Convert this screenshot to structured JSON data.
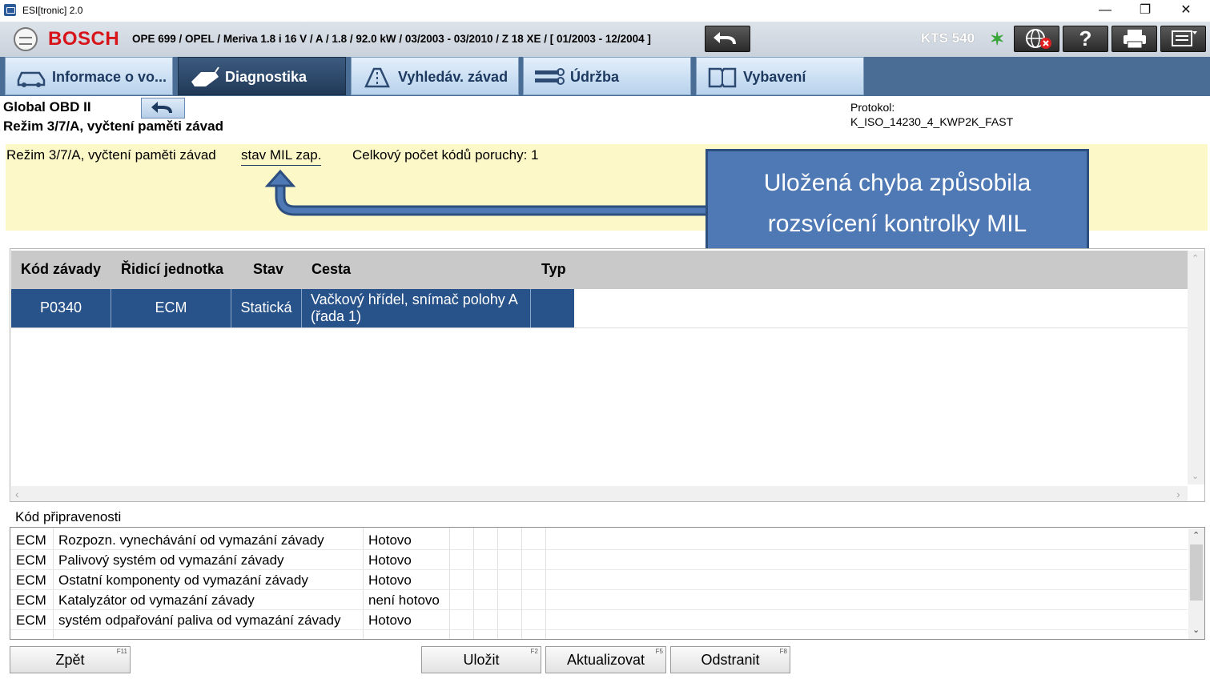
{
  "window": {
    "title": "ESI[tronic] 2.0"
  },
  "header": {
    "brand": "BOSCH",
    "vehicle_code": "OPE 699",
    "vehicle_rest": " / OPEL / Meriva 1.8 i 16 V / A / 1.8 / 92.0 kW / 03/2003 - 03/2010 / Z 18 XE / [ 01/2003 - 12/2004 ]",
    "device": "KTS 540"
  },
  "tabs": [
    {
      "label": "Informace o vo..."
    },
    {
      "label": "Diagnostika"
    },
    {
      "label": "Vyhledáv. závad"
    },
    {
      "label": "Údržba"
    },
    {
      "label": "Vybavení"
    }
  ],
  "subheader": {
    "title": "Global OBD II",
    "subtitle": "Režim 3/7/A, vyčtení paměti závad",
    "protocol_label": "Protokol:",
    "protocol_value": "K_ISO_14230_4_KWP2K_FAST"
  },
  "status": {
    "mode": "Režim 3/7/A, vyčtení paměti závad",
    "mil": "stav MIL zap.",
    "count": "Celkový počet kódů poruchy: 1"
  },
  "callout": {
    "line1": "Uložená chyba způsobila",
    "line2": "rozsvícení kontrolky MIL"
  },
  "fault_table": {
    "headers": [
      "Kód závady",
      "Řidicí jednotka",
      "Stav",
      "Cesta",
      "Typ"
    ],
    "rows": [
      {
        "code": "P0340",
        "ecu": "ECM",
        "state": "Statická",
        "path_line1": "Vačkový hřídel, snímač polohy A",
        "path_line2": "(řada 1)",
        "type": ""
      }
    ]
  },
  "readiness": {
    "title": "Kód připravenosti",
    "rows": [
      {
        "ecu": "ECM",
        "test": "Rozpozn. vynechávání od vymazání závady",
        "status": "Hotovo"
      },
      {
        "ecu": "ECM",
        "test": "Palivový systém od vymazání závady",
        "status": "Hotovo"
      },
      {
        "ecu": "ECM",
        "test": "Ostatní komponenty od vymazání závady",
        "status": "Hotovo"
      },
      {
        "ecu": "ECM",
        "test": "Katalyzátor od vymazání závady",
        "status": "není hotovo"
      },
      {
        "ecu": "ECM",
        "test": "systém odpařování paliva od vymazání závady",
        "status": "Hotovo"
      }
    ]
  },
  "buttons": {
    "back": {
      "label": "Zpět",
      "key": "F11"
    },
    "save": {
      "label": "Uložit",
      "key": "F2"
    },
    "refresh": {
      "label": "Aktualizovat",
      "key": "F5"
    },
    "delete": {
      "label": "Odstranit",
      "key": "F8"
    }
  },
  "colors": {
    "brand_red": "#d8141a",
    "selection_blue": "#28528a",
    "status_yellow": "#fdf8c8",
    "callout_blue": "#4f79b4"
  }
}
